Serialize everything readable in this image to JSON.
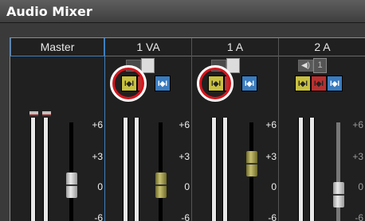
{
  "window": {
    "title": "Audio Mixer"
  },
  "channels": [
    {
      "name": "Master"
    },
    {
      "name": "1 VA"
    },
    {
      "name": "1 A"
    },
    {
      "name": "2 A"
    }
  ],
  "scale": [
    "+6",
    "+3",
    "0",
    "-6"
  ],
  "solo": {
    "track_1": "1"
  },
  "buttons": {
    "yellow": "I◆I",
    "red": "I◆I",
    "blue": "I◆I"
  },
  "colors": {
    "highlight_ring": "#d8141c",
    "button_yellow": "#c8c040",
    "button_red": "#b83030",
    "button_blue": "#3a7cc0"
  }
}
